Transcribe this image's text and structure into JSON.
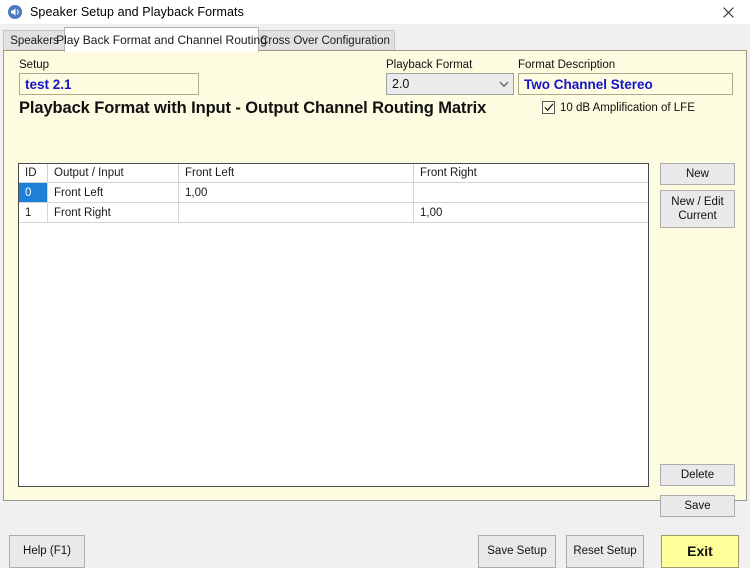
{
  "window": {
    "title": "Speaker Setup and Playback Formats",
    "icon": "speaker-icon",
    "close_label": "✕"
  },
  "tabs": [
    {
      "label": "Speakers",
      "selected": false
    },
    {
      "label": "Play Back Format and Channel Routing",
      "selected": true
    },
    {
      "label": "Cross Over Configuration",
      "selected": false
    }
  ],
  "form": {
    "setup_label": "Setup",
    "setup_value": "test 2.1",
    "playback_format_label": "Playback Format",
    "playback_format_value": "2.0",
    "playback_format_options": [
      "2.0"
    ],
    "format_description_label": "Format Description",
    "format_description_value": "Two Channel Stereo",
    "matrix_heading": "Playback Format with Input - Output Channel Routing Matrix",
    "lfe_checkbox_label": "10 dB Amplification of LFE",
    "lfe_checkbox_checked": true
  },
  "matrix": {
    "columns": [
      "ID",
      "Output / Input",
      "Front Left",
      "Front Right"
    ],
    "rows": [
      {
        "id": "0",
        "output": "Front Left",
        "front_left": "1,00",
        "front_right": "",
        "selected": true
      },
      {
        "id": "1",
        "output": "Front Right",
        "front_left": "",
        "front_right": "1,00",
        "selected": false
      }
    ]
  },
  "side_buttons": {
    "new": "New",
    "new_edit_current": "New / Edit\nCurrent",
    "delete": "Delete",
    "save": "Save"
  },
  "bottom_buttons": {
    "help": "Help (F1)",
    "save_setup": "Save Setup",
    "reset_setup": "Reset Setup",
    "exit": "Exit"
  },
  "colors": {
    "panel_yellow": "#fdfbe0",
    "accent_blue_text": "#1414c8",
    "selection_blue": "#1d7fd8",
    "exit_yellow": "#ffff99",
    "window_chrome": "#f0f0f0"
  }
}
